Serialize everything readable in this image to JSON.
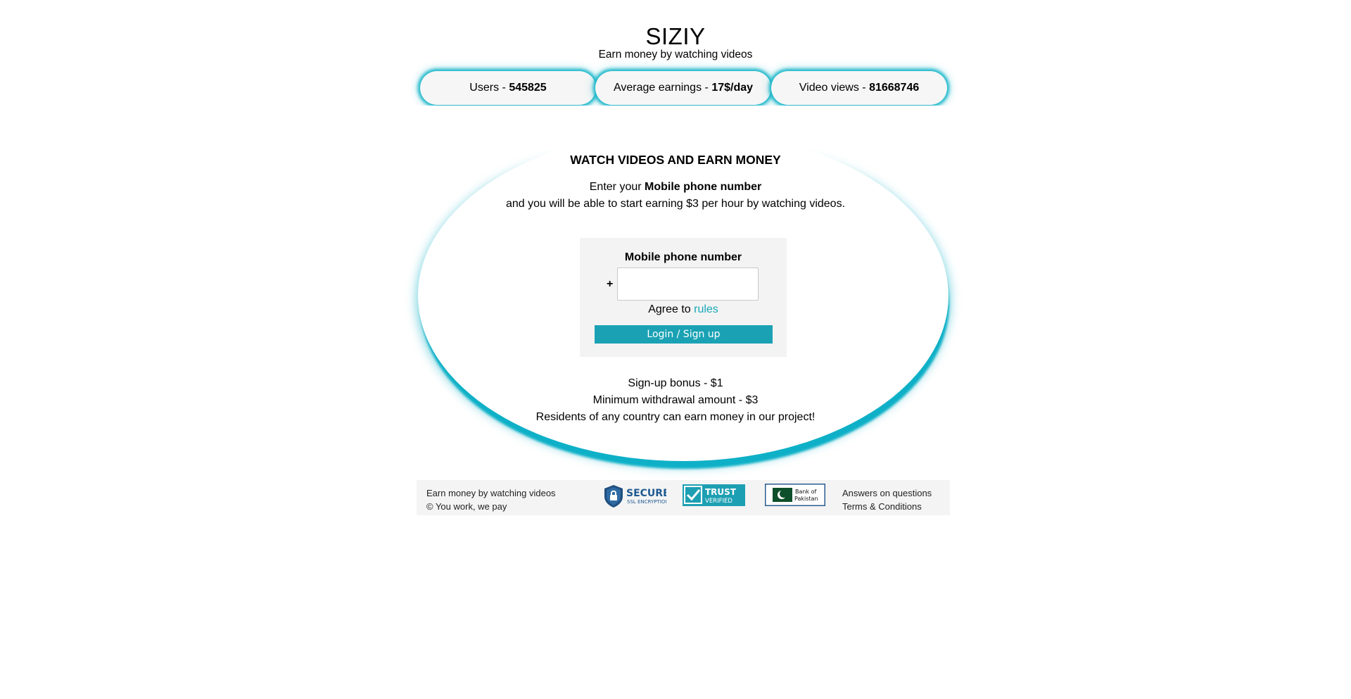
{
  "header": {
    "title": "SIZIY",
    "subtitle": "Earn money by watching videos"
  },
  "stats": {
    "users_label": "Users - ",
    "users_value": "545825",
    "earnings_label": "Average earnings - ",
    "earnings_value": "17$/day",
    "views_label": "Video views - ",
    "views_value": "81668746"
  },
  "main": {
    "heading": "WATCH VIDEOS AND EARN MONEY",
    "intro_prefix": "Enter your ",
    "intro_bold": "Mobile phone number",
    "intro_line2": "and you will be able to start earning $3 per hour by watching videos."
  },
  "form": {
    "label": "Mobile phone number",
    "prefix": "+",
    "phone_value": "",
    "agree_prefix": "Agree to ",
    "rules_link": "rules",
    "submit_label": "Login / Sign up"
  },
  "info": {
    "bonus": "Sign-up bonus - $1",
    "min_withdrawal": "Minimum withdrawal amount - $3",
    "residents": "Residents of any country can earn money in our project!"
  },
  "footer": {
    "line1": "Earn money by watching videos",
    "line2": "© You work, we pay",
    "badge_ssl_big": "SECURE",
    "badge_ssl_small": "SSL ENCRYPTION",
    "badge_trust_big": "TRUST",
    "badge_trust_small": "VERIFIED",
    "badge_bank_line1": "Bank of",
    "badge_bank_line2": "Pakistan",
    "link_questions": "Answers on questions",
    "link_terms": "Terms & Conditions"
  },
  "colors": {
    "accent": "#18b6c9",
    "button": "#1aa2b4",
    "link": "#16a7b8",
    "panel": "#f3f3f3"
  },
  "icons": {
    "ssl_badge": "lock-shield-icon",
    "trust_badge": "checkmark-icon",
    "bank_badge": "crescent-star-flag-icon"
  }
}
